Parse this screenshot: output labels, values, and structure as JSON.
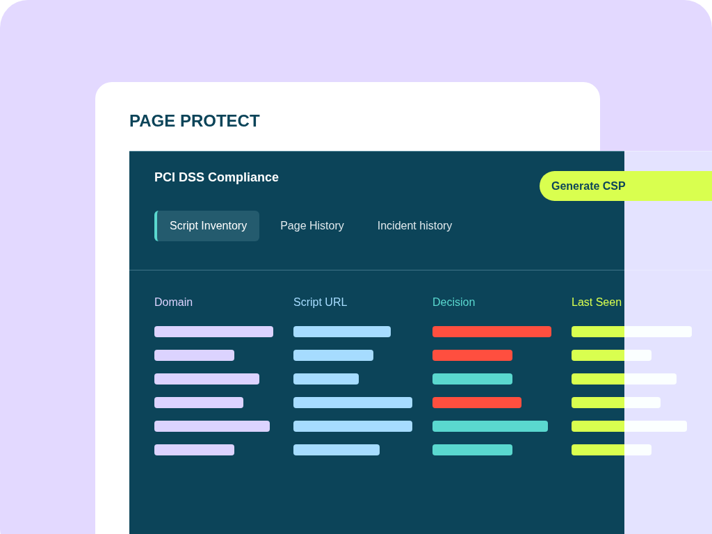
{
  "app_title": "PAGE PROTECT",
  "panel_title": "PCI DSS Compliance",
  "action_button": "Generate CSP",
  "tabs": [
    {
      "label": "Script Inventory",
      "selected": true
    },
    {
      "label": "Page History",
      "selected": false
    },
    {
      "label": "Incident history",
      "selected": false
    }
  ],
  "columns": [
    {
      "label": "Domain",
      "color": "#dcd3ff"
    },
    {
      "label": "Script URL",
      "color": "#a6dcff"
    },
    {
      "label": "Decision",
      "color": "#5ad8cf"
    },
    {
      "label": "Last Seen",
      "color": "#d9ff4f"
    }
  ],
  "rows": [
    {
      "cells": [
        {
          "level": 0.95
        },
        {
          "level": 0.78
        },
        {
          "level": 0.95,
          "color": "#ff4f3f"
        },
        {
          "level": 0.96
        }
      ]
    },
    {
      "cells": [
        {
          "level": 0.64
        },
        {
          "level": 0.64
        },
        {
          "level": 0.64,
          "color": "#ff4f3f"
        },
        {
          "level": 0.64
        }
      ]
    },
    {
      "cells": [
        {
          "level": 0.84
        },
        {
          "level": 0.52
        },
        {
          "level": 0.64,
          "color": "#5ad8cf"
        },
        {
          "level": 0.84
        }
      ]
    },
    {
      "cells": [
        {
          "level": 0.71
        },
        {
          "level": 0.95
        },
        {
          "level": 0.71,
          "color": "#ff4f3f"
        },
        {
          "level": 0.71
        }
      ]
    },
    {
      "cells": [
        {
          "level": 0.92
        },
        {
          "level": 0.95
        },
        {
          "level": 0.92,
          "color": "#5ad8cf"
        },
        {
          "level": 0.92
        }
      ]
    },
    {
      "cells": [
        {
          "level": 0.64
        },
        {
          "level": 0.69
        },
        {
          "level": 0.64,
          "color": "#5ad8cf"
        },
        {
          "level": 0.64
        }
      ]
    }
  ]
}
